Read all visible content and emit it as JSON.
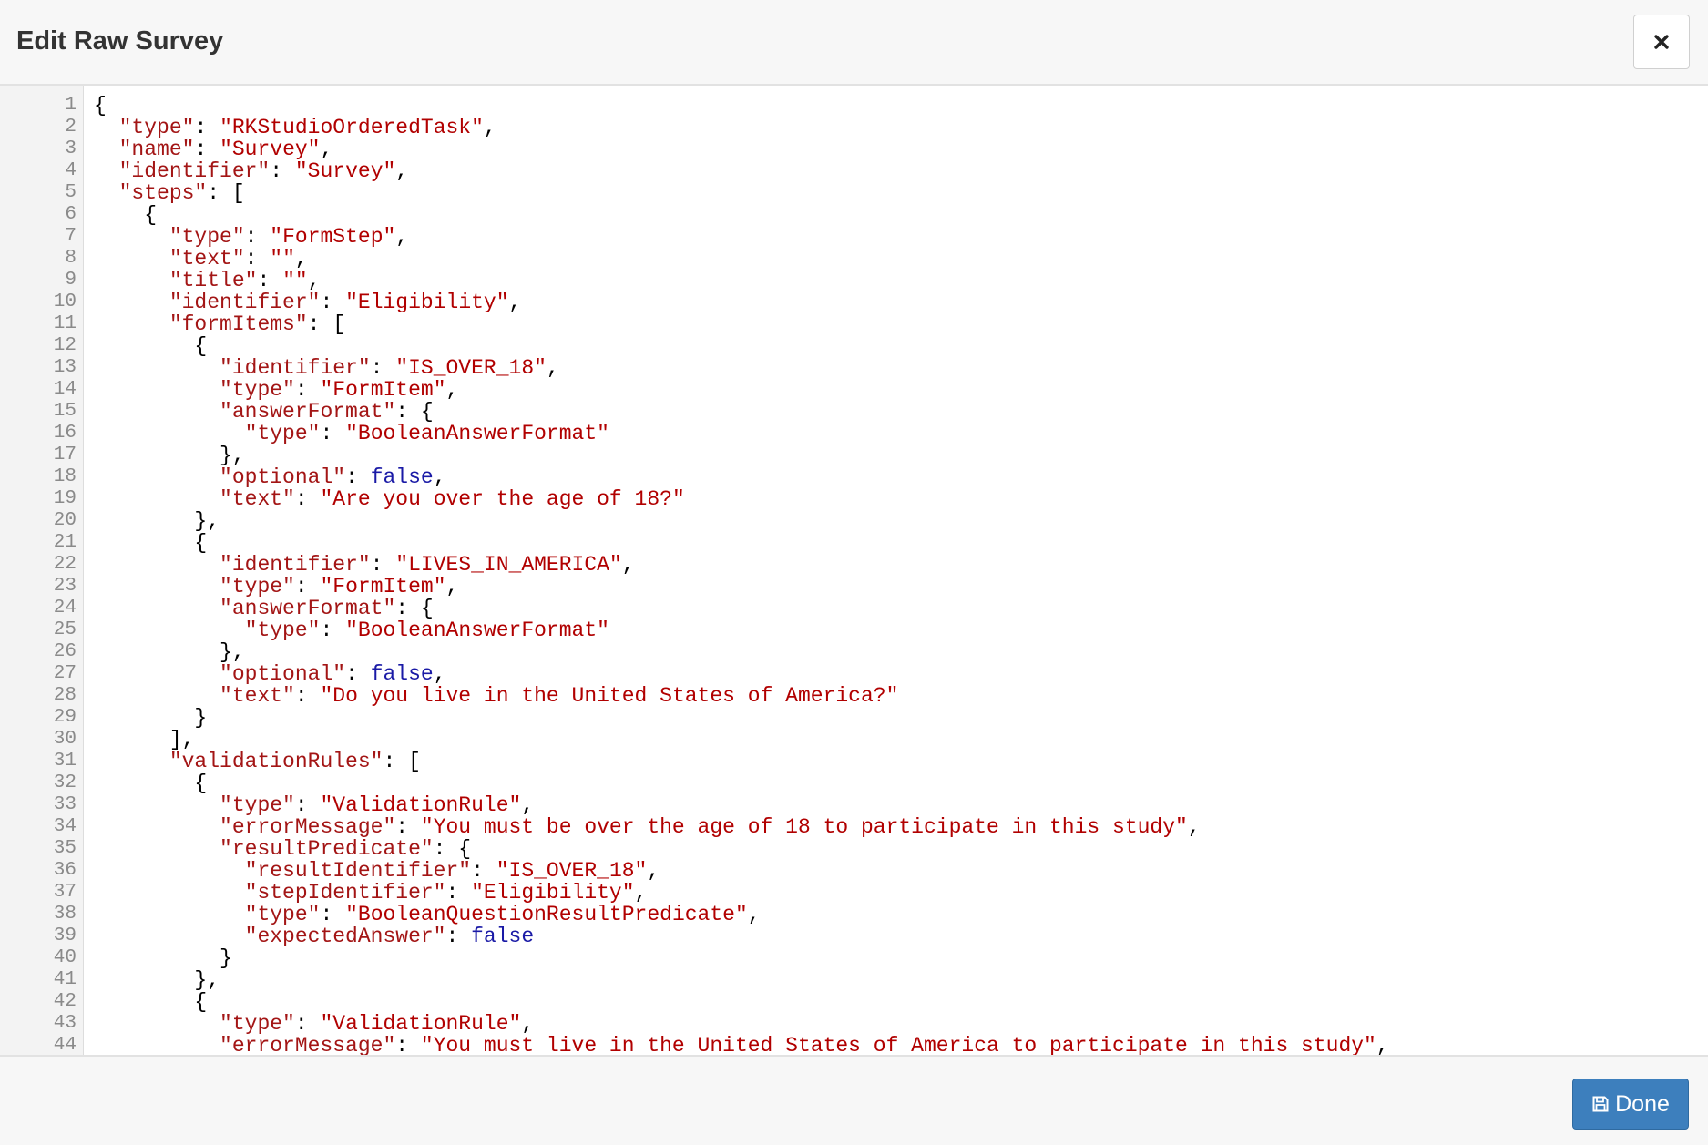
{
  "dialog": {
    "title": "Edit Raw Survey",
    "close_icon": "close-icon"
  },
  "editor": {
    "lines": [
      "{",
      "  \"type\": \"RKStudioOrderedTask\",",
      "  \"name\": \"Survey\",",
      "  \"identifier\": \"Survey\",",
      "  \"steps\": [",
      "    {",
      "      \"type\": \"FormStep\",",
      "      \"text\": \"\",",
      "      \"title\": \"\",",
      "      \"identifier\": \"Eligibility\",",
      "      \"formItems\": [",
      "        {",
      "          \"identifier\": \"IS_OVER_18\",",
      "          \"type\": \"FormItem\",",
      "          \"answerFormat\": {",
      "            \"type\": \"BooleanAnswerFormat\"",
      "          },",
      "          \"optional\": false,",
      "          \"text\": \"Are you over the age of 18?\"",
      "        },",
      "        {",
      "          \"identifier\": \"LIVES_IN_AMERICA\",",
      "          \"type\": \"FormItem\",",
      "          \"answerFormat\": {",
      "            \"type\": \"BooleanAnswerFormat\"",
      "          },",
      "          \"optional\": false,",
      "          \"text\": \"Do you live in the United States of America?\"",
      "        }",
      "      ],",
      "      \"validationRules\": [",
      "        {",
      "          \"type\": \"ValidationRule\",",
      "          \"errorMessage\": \"You must be over the age of 18 to participate in this study\",",
      "          \"resultPredicate\": {",
      "            \"resultIdentifier\": \"IS_OVER_18\",",
      "            \"stepIdentifier\": \"Eligibility\",",
      "            \"type\": \"BooleanQuestionResultPredicate\",",
      "            \"expectedAnswer\": false",
      "          }",
      "        },",
      "        {",
      "          \"type\": \"ValidationRule\",",
      "          \"errorMessage\": \"You must live in the United States of America to participate in this study\","
    ],
    "colors": {
      "key": "#a31515",
      "string": "#b10000",
      "boolean": "#1a1aa6",
      "line_number": "#8a8a8a",
      "gutter_bg": "#f3f3f3"
    }
  },
  "footer": {
    "done_label": "Done",
    "done_icon": "save-icon",
    "accent": "#3d7fbd"
  }
}
